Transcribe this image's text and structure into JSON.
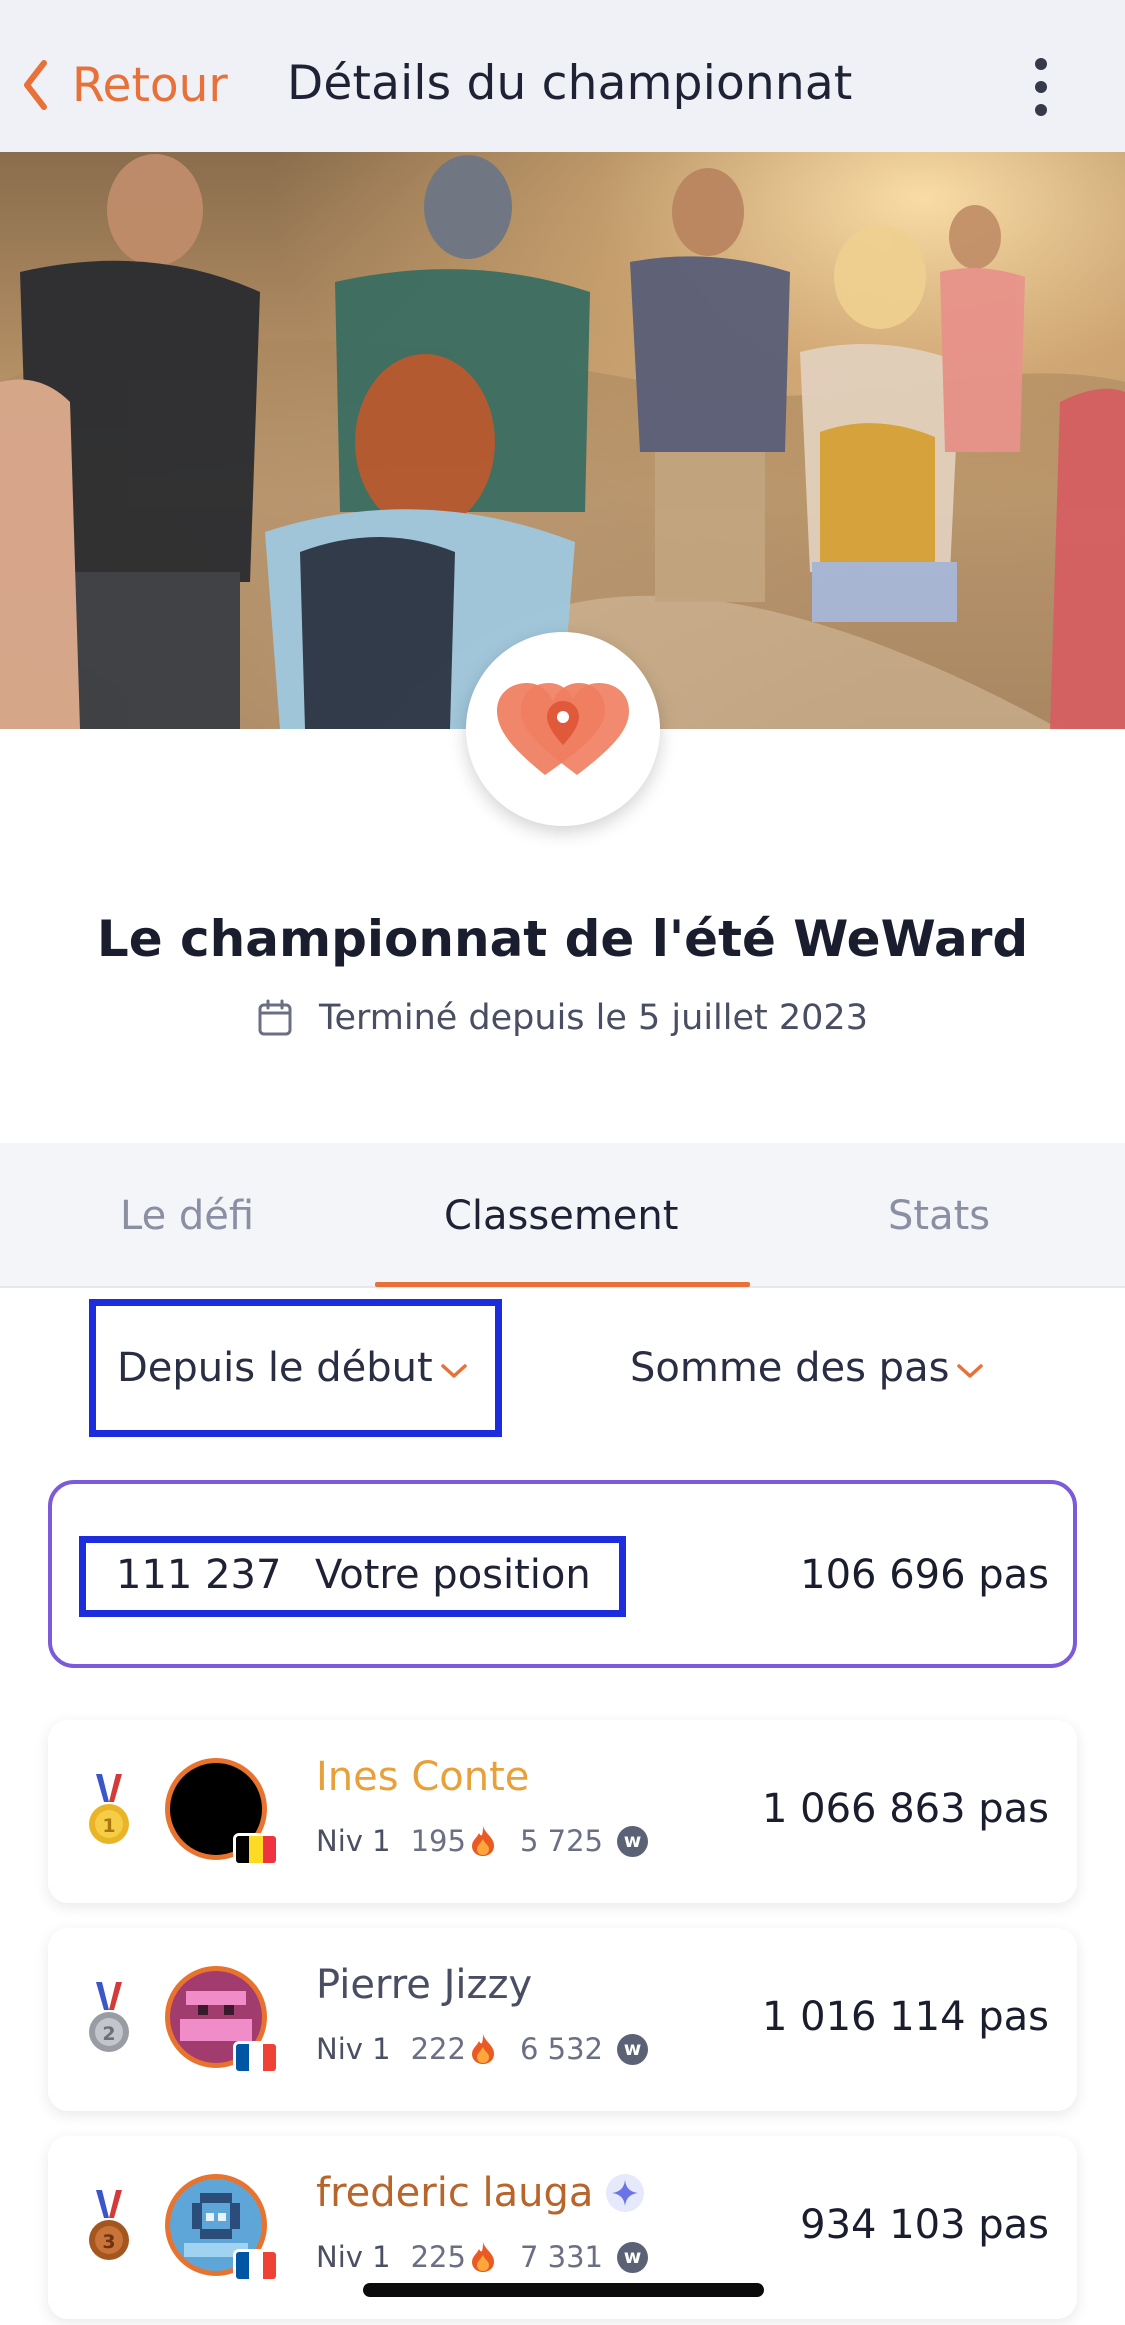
{
  "nav": {
    "back_label": "Retour",
    "title": "Détails du championnat"
  },
  "championship": {
    "title": "Le championnat de l'été WeWard",
    "date_text": "Terminé depuis le 5 juillet 2023"
  },
  "tabs": [
    {
      "label": "Le défi",
      "active": false
    },
    {
      "label": "Classement",
      "active": true
    },
    {
      "label": "Stats",
      "active": false
    }
  ],
  "filters": {
    "period": "Depuis le début",
    "metric": "Somme des pas"
  },
  "my_position": {
    "rank": "111 237",
    "label": "Votre position",
    "steps": "106 696 pas"
  },
  "leaderboard": [
    {
      "rank": 1,
      "name": "Ines Conte",
      "level": "Niv 1",
      "streak": "195",
      "wards": "5 725",
      "steps": "1 066 863 pas",
      "name_color": "#e8a03a",
      "flag": [
        "#000000",
        "#fdda24",
        "#ef3340"
      ],
      "verified": false
    },
    {
      "rank": 2,
      "name": "Pierre Jizzy",
      "level": "Niv 1",
      "streak": "222",
      "wards": "6 532",
      "steps": "1 016 114 pas",
      "name_color": "#4a4e63",
      "flag": [
        "#0055a4",
        "#ffffff",
        "#ef4135"
      ],
      "verified": false
    },
    {
      "rank": 3,
      "name": "frederic lauga",
      "level": "Niv 1",
      "streak": "225",
      "wards": "7 331",
      "steps": "934 103 pas",
      "name_color": "#b8652b",
      "flag": [
        "#0055a4",
        "#ffffff",
        "#ef4135"
      ],
      "verified": true
    }
  ],
  "colors": {
    "accent": "#e8713a",
    "highlight_box": "#1d2dde",
    "position_border": "#7b5bd9"
  },
  "icons": {
    "back": "chevron-left-icon",
    "more": "more-vertical-icon",
    "calendar": "calendar-icon",
    "dropdown": "chevron-down-icon",
    "streak": "flame-icon",
    "currency": "ward-coin-icon"
  }
}
